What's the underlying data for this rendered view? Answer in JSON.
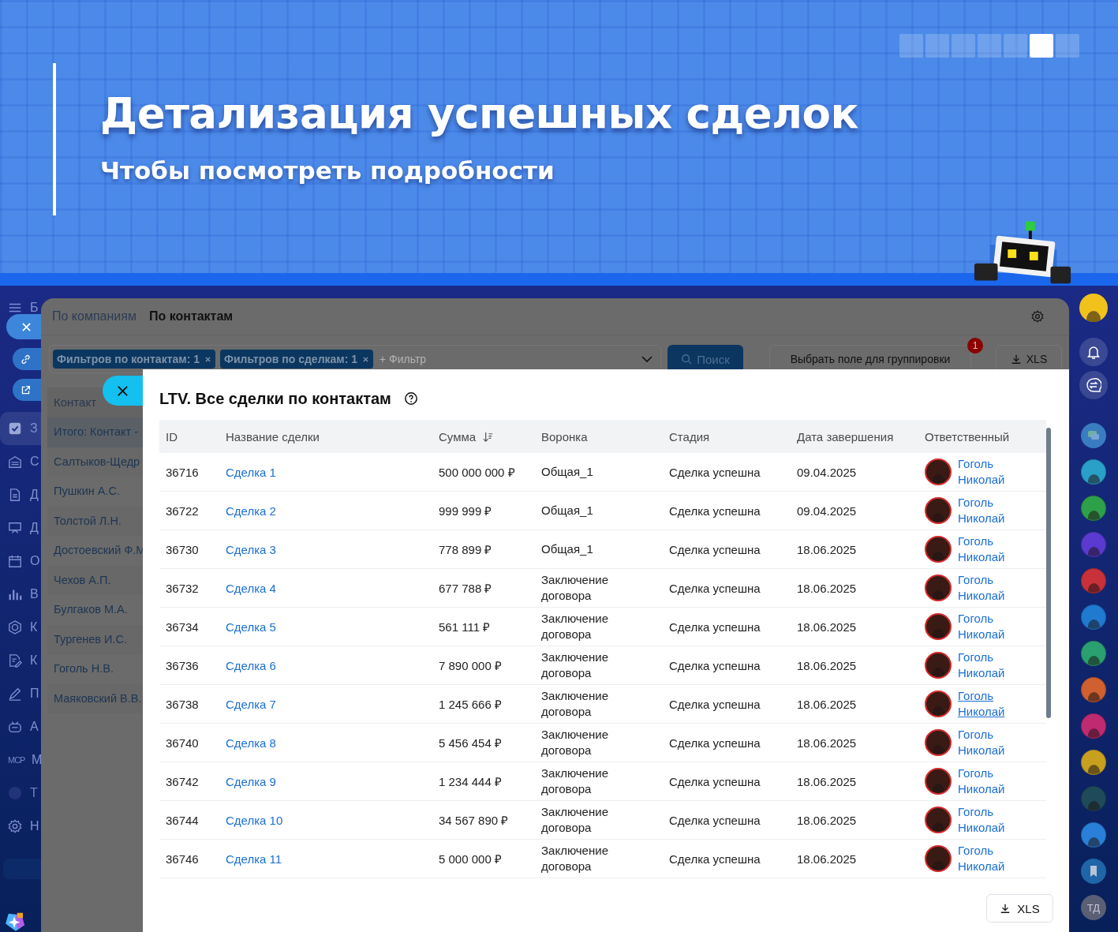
{
  "banner": {
    "title": "Детализация успешных сделок",
    "subtitle": "Чтобы посмотреть подробности",
    "slides": [
      {
        "selected": false
      },
      {
        "selected": false
      },
      {
        "selected": false
      },
      {
        "selected": false
      },
      {
        "selected": false
      },
      {
        "selected": true
      },
      {
        "selected": false
      }
    ]
  },
  "sidebar": {
    "items": [
      {
        "kind": "menu",
        "letter": "Б",
        "selected": false
      },
      {
        "kind": "tasks",
        "letter": "З",
        "selected": true
      },
      {
        "kind": "garage",
        "letter": "С",
        "selected": false
      },
      {
        "kind": "doc",
        "letter": "Д",
        "selected": false
      },
      {
        "kind": "board",
        "letter": "Д",
        "selected": false
      },
      {
        "kind": "calendar",
        "letter": "О",
        "selected": false
      },
      {
        "kind": "chart",
        "letter": "В",
        "selected": false
      },
      {
        "kind": "hex",
        "letter": "К",
        "selected": false
      },
      {
        "kind": "docedit",
        "letter": "К",
        "selected": false
      },
      {
        "kind": "pen",
        "letter": "П",
        "selected": false
      },
      {
        "kind": "robot",
        "letter": "А",
        "selected": false
      },
      {
        "kind": "mcp",
        "icon_text": "MCP",
        "letter": "М",
        "selected": false
      },
      {
        "kind": "avatar",
        "letter": "Т",
        "selected": false
      },
      {
        "kind": "gear",
        "letter": "Н",
        "selected": false
      }
    ]
  },
  "page": {
    "tabs": [
      {
        "label": "По компаниям",
        "selected": false
      },
      {
        "label": "По контактам",
        "selected": true
      }
    ],
    "filter_field": {
      "chips": [
        "Фильтров по контактам: 1",
        "Фильтров по сделкам: 1"
      ],
      "placeholder": "+ Фильтр"
    },
    "search_button": "Поиск",
    "group_select": "Выбрать поле для группировки",
    "group_badge": "1",
    "export_button": "XLS",
    "contacts": {
      "header": "Контакт",
      "rows": [
        {
          "name": "Итого: Контакт -",
          "kind": "total"
        },
        {
          "name": "Салтыков-Щедр",
          "kind": "contact"
        },
        {
          "name": "Пушкин А.С.",
          "kind": "contact"
        },
        {
          "name": "Толстой Л.Н.",
          "kind": "contact"
        },
        {
          "name": "Достоевский Ф.М",
          "kind": "contact"
        },
        {
          "name": "Чехов А.П.",
          "kind": "contact"
        },
        {
          "name": "Булгаков М.А.",
          "kind": "contact"
        },
        {
          "name": "Тургенев И.С.",
          "kind": "contact"
        },
        {
          "name": "Гоголь Н.В.",
          "kind": "contact"
        },
        {
          "name": "Маяковский В.В.",
          "kind": "contact"
        }
      ]
    }
  },
  "right_rail": [
    {
      "kind": "user"
    },
    {
      "kind": "bell"
    },
    {
      "kind": "swap"
    },
    {
      "kind": "chat"
    },
    {
      "kind": "avatar",
      "color": "#2aa0c8"
    },
    {
      "kind": "avatar",
      "color": "#2fa04a"
    },
    {
      "kind": "avatar",
      "color": "#5a3ad0"
    },
    {
      "kind": "avatar",
      "color": "#c8303a"
    },
    {
      "kind": "avatar",
      "color": "#1f7ad0"
    },
    {
      "kind": "avatar",
      "color": "#2aa070"
    },
    {
      "kind": "avatar",
      "color": "#d06030"
    },
    {
      "kind": "avatar",
      "color": "#c02a70"
    },
    {
      "kind": "avatar",
      "color": "#c8a020"
    },
    {
      "kind": "avatar",
      "color": "#1f4a5a"
    },
    {
      "kind": "avatar",
      "color": "#2a80d8"
    },
    {
      "kind": "bookmark"
    },
    {
      "kind": "initials",
      "text": "ТД"
    }
  ],
  "modal": {
    "title": "LTV. Все сделки по контактам",
    "columns": [
      {
        "label": "ID",
        "sorted": false
      },
      {
        "label": "Название сделки",
        "sorted": false
      },
      {
        "label": "Сумма",
        "sorted": true
      },
      {
        "label": "Воронка",
        "sorted": false
      },
      {
        "label": "Стадия",
        "sorted": false
      },
      {
        "label": "Дата завершения",
        "sorted": false
      },
      {
        "label": "Ответственный",
        "sorted": false
      }
    ],
    "rows": [
      {
        "id": "36716",
        "name": "Сделка 1",
        "amount": "500 000 000 ₽",
        "funnel": "Общая_1",
        "stage": "Сделка успешна",
        "date": "09.04.2025",
        "responsible": "Гоголь Николай",
        "hovered": false
      },
      {
        "id": "36722",
        "name": "Сделка 2",
        "amount": "999 999 ₽",
        "funnel": "Общая_1",
        "stage": "Сделка успешна",
        "date": "09.04.2025",
        "responsible": "Гоголь Николай",
        "hovered": false
      },
      {
        "id": "36730",
        "name": "Сделка 3",
        "amount": "778 899 ₽",
        "funnel": "Общая_1",
        "stage": "Сделка успешна",
        "date": "18.06.2025",
        "responsible": "Гоголь Николай",
        "hovered": false
      },
      {
        "id": "36732",
        "name": "Сделка 4",
        "amount": "677 788 ₽",
        "funnel": "Заключение договора",
        "stage": "Сделка успешна",
        "date": "18.06.2025",
        "responsible": "Гоголь Николай",
        "hovered": false
      },
      {
        "id": "36734",
        "name": "Сделка 5",
        "amount": "561 111 ₽",
        "funnel": "Заключение договора",
        "stage": "Сделка успешна",
        "date": "18.06.2025",
        "responsible": "Гоголь Николай",
        "hovered": false
      },
      {
        "id": "36736",
        "name": "Сделка 6",
        "amount": "7 890 000 ₽",
        "funnel": "Заключение договора",
        "stage": "Сделка успешна",
        "date": "18.06.2025",
        "responsible": "Гоголь Николай",
        "hovered": false
      },
      {
        "id": "36738",
        "name": "Сделка 7",
        "amount": "1 245 666 ₽",
        "funnel": "Заключение договора",
        "stage": "Сделка успешна",
        "date": "18.06.2025",
        "responsible": "Гоголь Николай",
        "hovered": true
      },
      {
        "id": "36740",
        "name": "Сделка 8",
        "amount": "5 456 454 ₽",
        "funnel": "Заключение договора",
        "stage": "Сделка успешна",
        "date": "18.06.2025",
        "responsible": "Гоголь Николай",
        "hovered": false
      },
      {
        "id": "36742",
        "name": "Сделка 9",
        "amount": "1 234 444 ₽",
        "funnel": "Заключение договора",
        "stage": "Сделка успешна",
        "date": "18.06.2025",
        "responsible": "Гоголь Николай",
        "hovered": false
      },
      {
        "id": "36744",
        "name": "Сделка 10",
        "amount": "34 567 890 ₽",
        "funnel": "Заключение договора",
        "stage": "Сделка успешна",
        "date": "18.06.2025",
        "responsible": "Гоголь Николай",
        "hovered": false
      },
      {
        "id": "36746",
        "name": "Сделка 11",
        "amount": "5 000 000 ₽",
        "funnel": "Заключение договора",
        "stage": "Сделка успешна",
        "date": "18.06.2025",
        "responsible": "Гоголь Николай",
        "hovered": false
      }
    ],
    "export_button": "XLS"
  }
}
